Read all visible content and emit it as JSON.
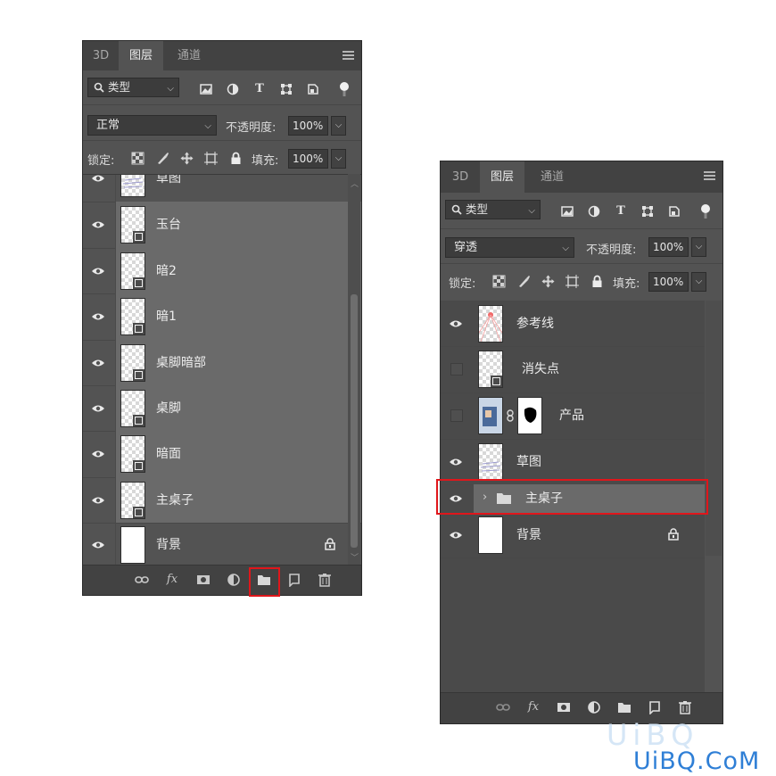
{
  "panel_left": {
    "tabs": [
      "3D",
      "图层",
      "通道"
    ],
    "active_tab": "图层",
    "filter": {
      "label": "类型"
    },
    "blend_mode": "正常",
    "opacity_label": "不透明度:",
    "opacity_value": "100%",
    "lock_label": "锁定:",
    "fill_label": "填充:",
    "fill_value": "100%",
    "layers": [
      {
        "name": "草图",
        "visible": true,
        "thumb": "sketch"
      },
      {
        "name": "玉台",
        "visible": true,
        "thumb": "smart"
      },
      {
        "name": "暗2",
        "visible": true,
        "thumb": "smart"
      },
      {
        "name": "暗1",
        "visible": true,
        "thumb": "smart"
      },
      {
        "name": "桌脚暗部",
        "visible": true,
        "thumb": "smart"
      },
      {
        "name": "桌脚",
        "visible": true,
        "thumb": "smart"
      },
      {
        "name": "暗面",
        "visible": true,
        "thumb": "smart"
      },
      {
        "name": "主桌子",
        "visible": true,
        "thumb": "smart"
      },
      {
        "name": "背景",
        "visible": true,
        "thumb": "white",
        "locked": true
      }
    ],
    "footer_icons": [
      "link-layers-icon",
      "fx-icon",
      "mask-icon",
      "adjustment-icon",
      "new-group-icon",
      "new-layer-icon",
      "trash-icon"
    ]
  },
  "panel_right": {
    "tabs": [
      "3D",
      "图层",
      "通道"
    ],
    "active_tab": "图层",
    "filter": {
      "label": "类型"
    },
    "blend_mode": "穿透",
    "opacity_label": "不透明度:",
    "opacity_value": "100%",
    "lock_label": "锁定:",
    "fill_label": "填充:",
    "fill_value": "100%",
    "layers": [
      {
        "name": "参考线",
        "visible": true,
        "thumb": "guides"
      },
      {
        "name": "消失点",
        "visible": false,
        "thumb": "smart"
      },
      {
        "name": "产品",
        "visible": false,
        "thumb": "product",
        "mask": true
      },
      {
        "name": "草图",
        "visible": true,
        "thumb": "sketch"
      },
      {
        "name": "主桌子",
        "visible": true,
        "thumb": "group"
      },
      {
        "name": "背景",
        "visible": true,
        "thumb": "white",
        "locked": true
      }
    ]
  },
  "watermark": {
    "logo_text": "UiBQ.CoM",
    "faint_text": "UiBQ"
  },
  "colors": {
    "panel": "#535353",
    "highlight": "#e0161b",
    "row_selected": "#6a6a6a"
  }
}
